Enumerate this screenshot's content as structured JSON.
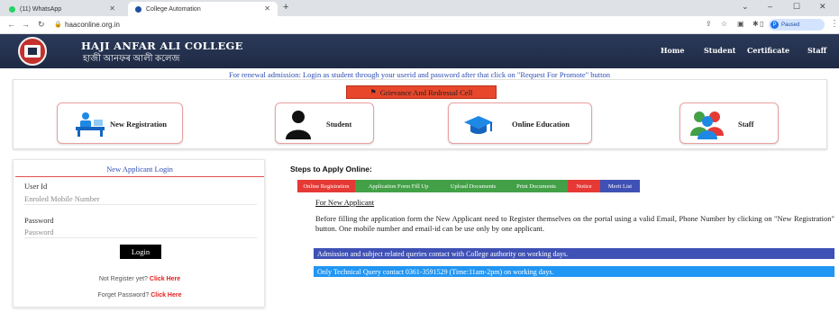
{
  "browser": {
    "tabs": [
      {
        "title": "(11) WhatsApp",
        "active": false,
        "favicon_color": "#25d366"
      },
      {
        "title": "College Automation",
        "active": true,
        "favicon_color": "#1f4fa0"
      }
    ],
    "new_tab_symbol": "+",
    "url": "haaconline.org.in",
    "profile_label": "Paused",
    "window_controls": [
      "⌄",
      "–",
      "☐",
      "✕"
    ]
  },
  "header": {
    "college_name_en": "HAJI ANFAR ALI COLLEGE",
    "college_name_bn": "হাজী আনফৰ আলী কলেজ",
    "nav": [
      "Home",
      "Student",
      "Certificate",
      "Staff"
    ]
  },
  "notice": "For renewal admission: Login as student through your userid and password after that click on \"Request For Promote\" button",
  "quick_links": {
    "grievance_label": "Grievance And Redressal Cell",
    "cards": [
      {
        "label": "New Registration",
        "icon": "registration-desk-icon"
      },
      {
        "label": "Student",
        "icon": "student-silhouette-icon"
      },
      {
        "label": "Online Education",
        "icon": "graduation-cap-icon"
      },
      {
        "label": "Staff",
        "icon": "staff-group-icon"
      }
    ]
  },
  "login": {
    "title": "New Applicant Login",
    "user_label": "User Id",
    "user_placeholder": "Enroled Mobile Number",
    "password_label": "Password",
    "password_placeholder": "Password",
    "login_button": "Login",
    "register_prompt": "Not Register yet?",
    "register_link": "Click Here",
    "forgot_prompt": "Forget Password?",
    "forgot_link": "Click Here"
  },
  "steps": {
    "title": "Steps to Apply Online:",
    "tabs": [
      {
        "label": "Online Registration",
        "color": "#e53935"
      },
      {
        "label": "Application Form Fill Up",
        "color": "#43a047"
      },
      {
        "label": "Upload Documents",
        "color": "#43a047"
      },
      {
        "label": "Print Documents",
        "color": "#43a047"
      },
      {
        "label": "Notice",
        "color": "#e53935"
      },
      {
        "label": "Merit List",
        "color": "#3f51b5"
      }
    ],
    "section_title": "For New Applicant",
    "paragraph": "Before filling the application form the New Applicant need to Register themselves on the portal using a valid Email, Phone Number by clicking on \"New Registration\" button. One mobile number and email-id can be use only by one applicant.",
    "info_bar_1": "Admission and subject related queries contact with College authority on working days.",
    "info_bar_2": "Only Technical Query contact 0361-3591529 (Time:11am-2pm) on working days.",
    "info_bar_1_color": "#3f51b5",
    "info_bar_2_color": "#2196f3"
  }
}
